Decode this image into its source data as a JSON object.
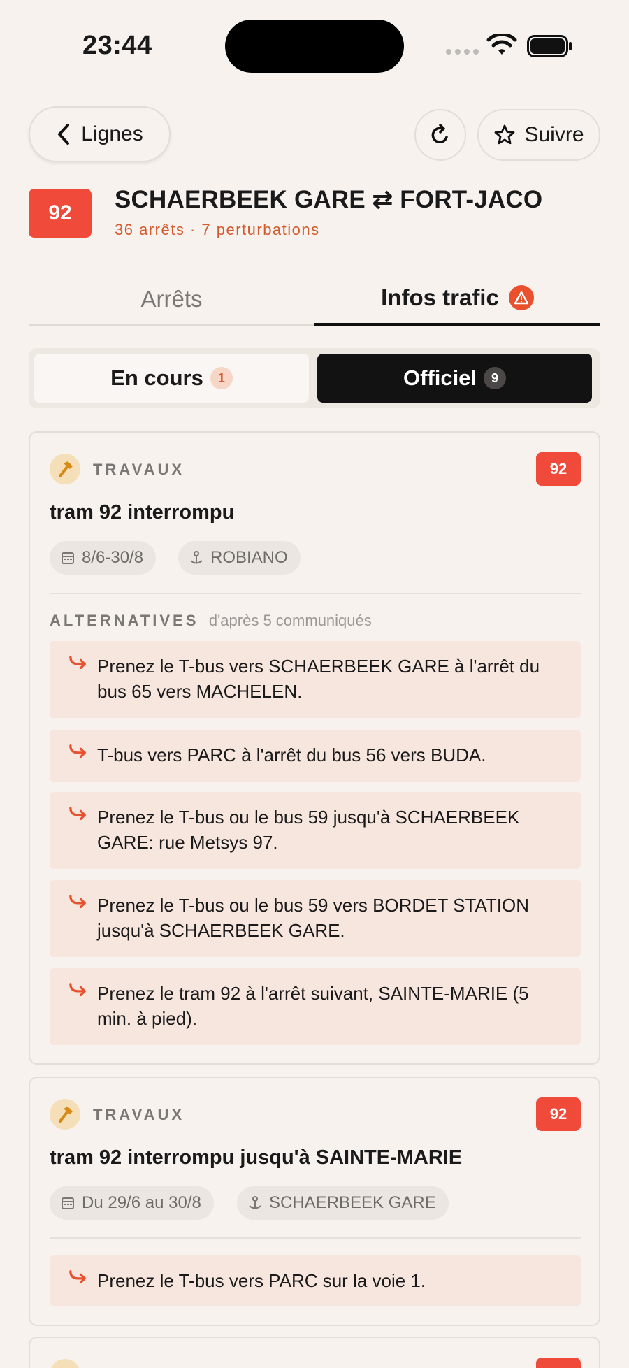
{
  "status_bar": {
    "time": "23:44"
  },
  "nav": {
    "back_label": "Lignes",
    "follow_label": "Suivre"
  },
  "line": {
    "number": "92",
    "title": "SCHAERBEEK GARE ⇄ FORT-JACO",
    "subtitle": "36 arrêts · 7 perturbations",
    "color": "#f04a3a"
  },
  "tabs": [
    {
      "label": "Arrêts",
      "active": false
    },
    {
      "label": "Infos trafic",
      "active": true,
      "icon": "warning-icon"
    }
  ],
  "segment": [
    {
      "label": "En cours",
      "count": "1",
      "active": false
    },
    {
      "label": "Officiel",
      "count": "9",
      "active": true
    }
  ],
  "disruptions": [
    {
      "category": "TRAVAUX",
      "category_icon": "hammer-icon",
      "line": "92",
      "title": "tram 92 interrompu",
      "date": "8/6-30/8",
      "stop": "ROBIANO",
      "alternatives_title": "ALTERNATIVES",
      "alternatives_source": "d'après 5 communiqués",
      "alternatives": [
        "Prenez le T-bus vers SCHAERBEEK GARE à l'arrêt du bus 65 vers MACHELEN.",
        "T-bus vers PARC à l'arrêt du bus 56 vers BUDA.",
        "Prenez le T-bus ou le bus 59 jusqu'à SCHAERBEEK GARE: rue Metsys 97.",
        "Prenez le T-bus ou le bus 59 vers BORDET STATION jusqu'à SCHAERBEEK GARE.",
        "Prenez le tram 92 à l'arrêt suivant, SAINTE-MARIE (5 min. à pied)."
      ]
    },
    {
      "category": "TRAVAUX",
      "category_icon": "hammer-icon",
      "line": "92",
      "title": "tram 92 interrompu jusqu'à SAINTE-MARIE",
      "date": "Du 29/6 au 30/8",
      "stop": "SCHAERBEEK GARE",
      "alternatives": [
        "Prenez le T-bus vers PARC sur la voie 1."
      ]
    },
    {
      "category_icon": "hammer-icon",
      "line": "92"
    }
  ],
  "colors": {
    "accent": "#d35a2e",
    "badge": "#f04a3a",
    "background": "#f7f2ee",
    "alt_bg": "#f6e6de"
  }
}
